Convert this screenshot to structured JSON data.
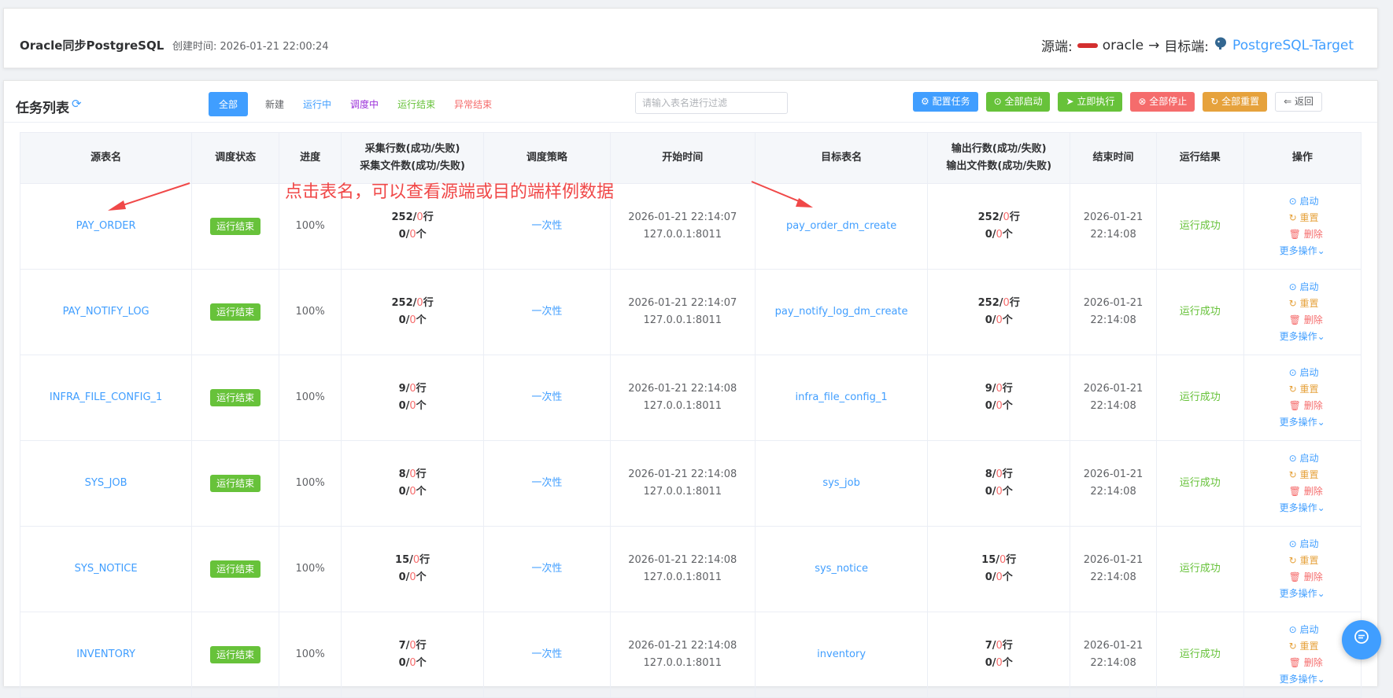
{
  "top": {
    "title": "Oracle同步PostgreSQL",
    "created": "创建时间: 2026-01-21 22:00:24",
    "source_label": "源端:",
    "source_name": "oracle",
    "arrow": "→",
    "target_label": "目标端:",
    "target_name": "PostgreSQL-Target"
  },
  "header": {
    "title": "任务列表",
    "filters": [
      "全部",
      "新建",
      "运行中",
      "调度中",
      "运行结束",
      "异常结束"
    ],
    "filter_colors": [
      "#ffffff",
      "#606266",
      "#409eff",
      "#9b30d9",
      "#67c23a",
      "#f56c6c"
    ],
    "filter_placeholder": "请输入表名进行过滤",
    "actions": [
      {
        "label": "⚙ 配置任务",
        "color": "#409eff"
      },
      {
        "label": "⊙ 全部启动",
        "color": "#67c23a"
      },
      {
        "label": "➤ 立即执行",
        "color": "#67c23a"
      },
      {
        "label": "⊗ 全部停止",
        "color": "#f56c6c"
      },
      {
        "label": "↻ 全部重置",
        "color": "#e6a23c"
      }
    ],
    "back": "⇐ 返回"
  },
  "columns": [
    "源表名",
    "调度状态",
    "进度",
    "采集行数(成功/失败)",
    "采集文件数(成功/失败)",
    "调度策略",
    "开始时间",
    "目标表名",
    "输出行数(成功/失败)",
    "输出文件数(成功/失败)",
    "结束时间",
    "运行结果",
    "操作"
  ],
  "rows": [
    {
      "src": "PAY_ORDER",
      "status": "运行结束",
      "progress": "100%",
      "rows_ok": "252",
      "rows_fail": "0",
      "files_ok": "0",
      "files_fail": "0",
      "strategy": "一次性",
      "start": "2026-01-21 22:14:07",
      "host": "127.0.0.1:8011",
      "target": "pay_order_dm_create",
      "out_ok": "252",
      "out_fail": "0",
      "outf_ok": "0",
      "outf_fail": "0",
      "end_date": "2026-01-21",
      "end_time": "22:14:08",
      "result": "运行成功"
    },
    {
      "src": "PAY_NOTIFY_LOG",
      "status": "运行结束",
      "progress": "100%",
      "rows_ok": "252",
      "rows_fail": "0",
      "files_ok": "0",
      "files_fail": "0",
      "strategy": "一次性",
      "start": "2026-01-21 22:14:07",
      "host": "127.0.0.1:8011",
      "target": "pay_notify_log_dm_create",
      "out_ok": "252",
      "out_fail": "0",
      "outf_ok": "0",
      "outf_fail": "0",
      "end_date": "2026-01-21",
      "end_time": "22:14:08",
      "result": "运行成功"
    },
    {
      "src": "INFRA_FILE_CONFIG_1",
      "status": "运行结束",
      "progress": "100%",
      "rows_ok": "9",
      "rows_fail": "0",
      "files_ok": "0",
      "files_fail": "0",
      "strategy": "一次性",
      "start": "2026-01-21 22:14:08",
      "host": "127.0.0.1:8011",
      "target": "infra_file_config_1",
      "out_ok": "9",
      "out_fail": "0",
      "outf_ok": "0",
      "outf_fail": "0",
      "end_date": "2026-01-21",
      "end_time": "22:14:08",
      "result": "运行成功"
    },
    {
      "src": "SYS_JOB",
      "status": "运行结束",
      "progress": "100%",
      "rows_ok": "8",
      "rows_fail": "0",
      "files_ok": "0",
      "files_fail": "0",
      "strategy": "一次性",
      "start": "2026-01-21 22:14:08",
      "host": "127.0.0.1:8011",
      "target": "sys_job",
      "out_ok": "8",
      "out_fail": "0",
      "outf_ok": "0",
      "outf_fail": "0",
      "end_date": "2026-01-21",
      "end_time": "22:14:08",
      "result": "运行成功"
    },
    {
      "src": "SYS_NOTICE",
      "status": "运行结束",
      "progress": "100%",
      "rows_ok": "15",
      "rows_fail": "0",
      "files_ok": "0",
      "files_fail": "0",
      "strategy": "一次性",
      "start": "2026-01-21 22:14:08",
      "host": "127.0.0.1:8011",
      "target": "sys_notice",
      "out_ok": "15",
      "out_fail": "0",
      "outf_ok": "0",
      "outf_fail": "0",
      "end_date": "2026-01-21",
      "end_time": "22:14:08",
      "result": "运行成功"
    },
    {
      "src": "INVENTORY",
      "status": "运行结束",
      "progress": "100%",
      "rows_ok": "7",
      "rows_fail": "0",
      "files_ok": "0",
      "files_fail": "0",
      "strategy": "一次性",
      "start": "2026-01-21 22:14:08",
      "host": "127.0.0.1:8011",
      "target": "inventory",
      "out_ok": "7",
      "out_fail": "0",
      "outf_ok": "0",
      "outf_fail": "0",
      "end_date": "2026-01-21",
      "end_time": "22:14:08",
      "result": "运行成功"
    }
  ],
  "labels": {
    "row_unit": "行",
    "file_unit": "个",
    "slash": "/"
  },
  "ops": {
    "start": "启动",
    "reset": "重置",
    "delete": "删除",
    "more": "更多操作"
  },
  "annotation": "点击表名，可以查看源端或目的端样例数据"
}
